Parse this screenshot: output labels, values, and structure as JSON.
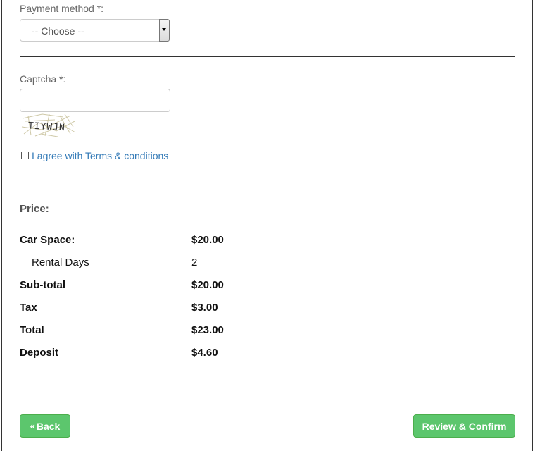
{
  "payment": {
    "label": "Payment method *:",
    "selected": "-- Choose --"
  },
  "captcha": {
    "label": "Captcha *:",
    "input_value": "",
    "image_text": "TIYWJN"
  },
  "terms": {
    "label": "I agree with Terms & conditions",
    "checked": false
  },
  "price": {
    "title": "Price:",
    "rows": [
      {
        "label": "Car Space:",
        "value": "$20.00"
      },
      {
        "label": "Rental Days",
        "value": "2"
      },
      {
        "label": "Sub-total",
        "value": "$20.00"
      },
      {
        "label": "Tax",
        "value": "$3.00"
      },
      {
        "label": "Total",
        "value": "$23.00"
      },
      {
        "label": "Deposit",
        "value": "$4.60"
      }
    ]
  },
  "footer": {
    "back_icon": "«",
    "back_label": "Back",
    "confirm_label": "Review & Confirm"
  },
  "colors": {
    "button_green": "#5cc66d",
    "link_blue": "#337ab7"
  }
}
